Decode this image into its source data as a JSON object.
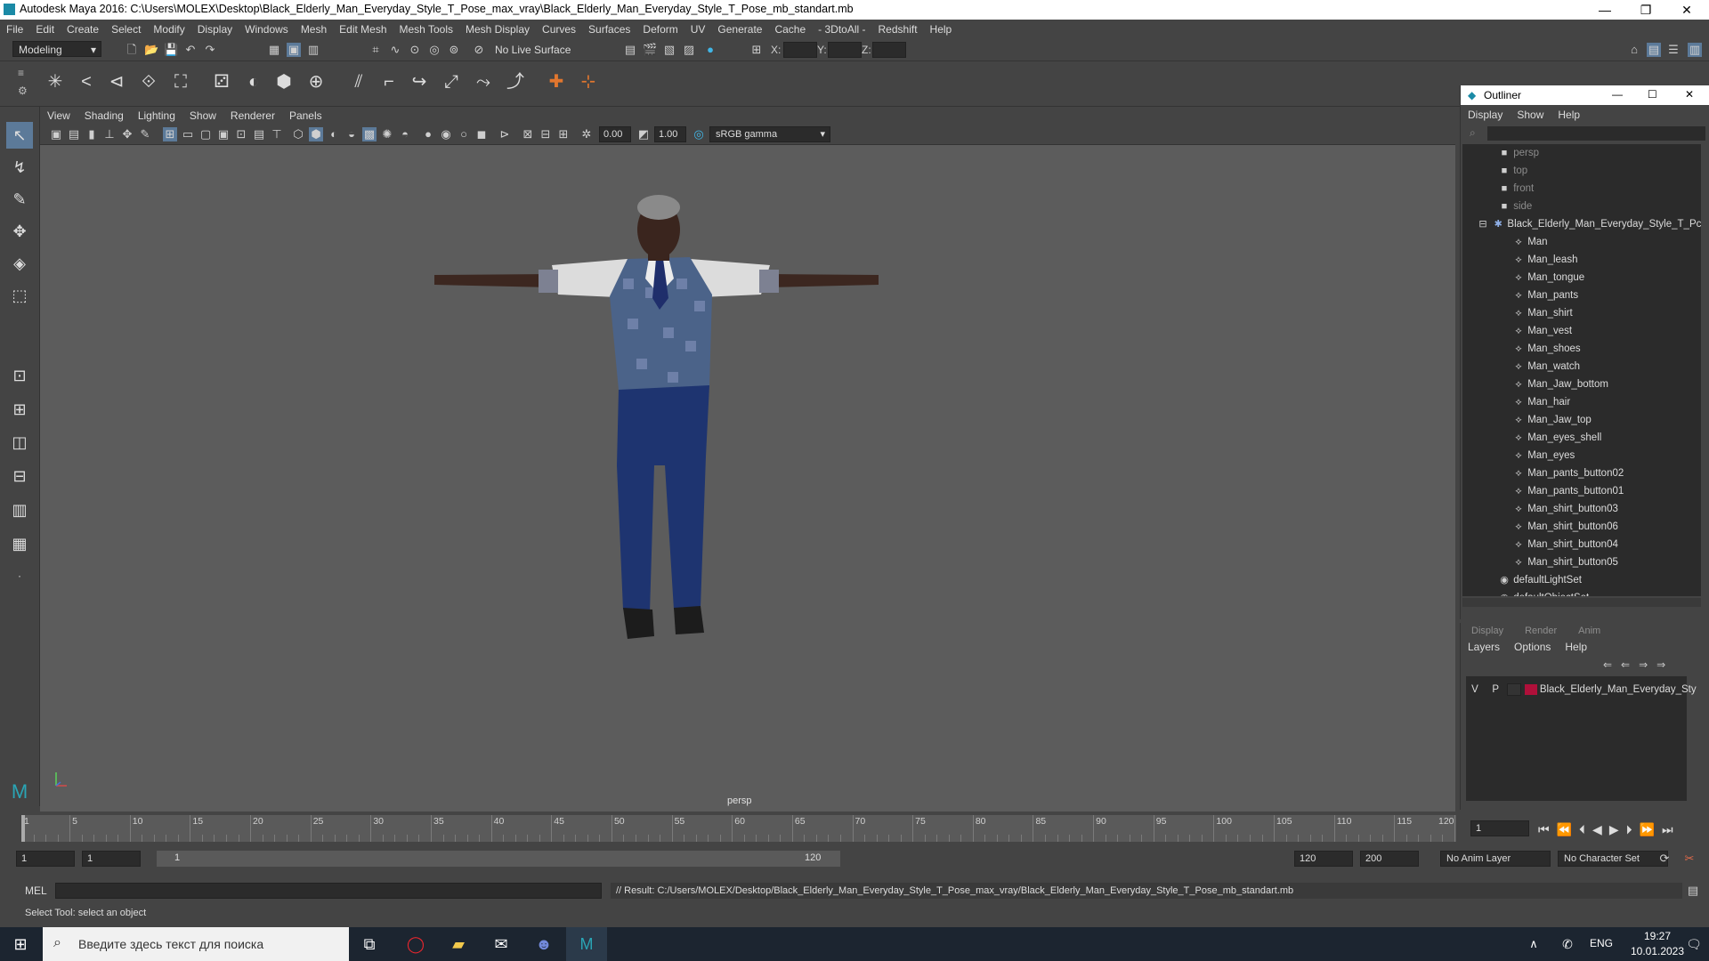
{
  "window": {
    "title": "Autodesk Maya 2016: C:\\Users\\MOLEX\\Desktop\\Black_Elderly_Man_Everyday_Style_T_Pose_max_vray\\Black_Elderly_Man_Everyday_Style_T_Pose_mb_standart.mb",
    "controls": [
      "—",
      "❐",
      "✕"
    ]
  },
  "menubar": [
    "File",
    "Edit",
    "Create",
    "Select",
    "Modify",
    "Display",
    "Windows",
    "Mesh",
    "Edit Mesh",
    "Mesh Tools",
    "Mesh Display",
    "Curves",
    "Surfaces",
    "Deform",
    "UV",
    "Generate",
    "Cache",
    "- 3DtoAll -",
    "Redshift",
    "Help"
  ],
  "statusline": {
    "workspace": "Modeling",
    "live_surface": "No Live Surface",
    "x_label": "X:",
    "y_label": "Y:",
    "z_label": "Z:"
  },
  "viewport": {
    "menu": [
      "View",
      "Shading",
      "Lighting",
      "Show",
      "Renderer",
      "Panels"
    ],
    "exposure": "0.00",
    "gamma": "1.00",
    "color_space": "sRGB gamma",
    "camera_label": "persp"
  },
  "outliner": {
    "title": "Outliner",
    "menu": [
      "Display",
      "Show",
      "Help"
    ],
    "cameras": [
      "persp",
      "top",
      "front",
      "side"
    ],
    "group": "Black_Elderly_Man_Everyday_Style_T_Pc",
    "children": [
      "Man",
      "Man_leash",
      "Man_tongue",
      "Man_pants",
      "Man_shirt",
      "Man_vest",
      "Man_shoes",
      "Man_watch",
      "Man_Jaw_bottom",
      "Man_hair",
      "Man_Jaw_top",
      "Man_eyes_shell",
      "Man_eyes",
      "Man_pants_button02",
      "Man_pants_button01",
      "Man_shirt_button03",
      "Man_shirt_button06",
      "Man_shirt_button04",
      "Man_shirt_button05"
    ],
    "sets": [
      "defaultLightSet",
      "defaultObjectSet"
    ]
  },
  "layer_editor": {
    "tabs": [
      "Display",
      "Render",
      "Anim"
    ],
    "menu": [
      "Layers",
      "Options",
      "Help"
    ],
    "layer": {
      "v": "V",
      "p": "P",
      "name": "Black_Elderly_Man_Everyday_Sty",
      "color": "#b0103a"
    }
  },
  "timeslider": {
    "ticks": [
      "1",
      "5",
      "10",
      "15",
      "20",
      "25",
      "30",
      "35",
      "40",
      "45",
      "50",
      "55",
      "60",
      "65",
      "70",
      "75",
      "80",
      "85",
      "90",
      "95",
      "100",
      "105",
      "110",
      "115",
      "120"
    ],
    "current_frame": "1"
  },
  "range": {
    "start": "1",
    "playback_start": "1",
    "slider_start": "1",
    "slider_end": "120",
    "playback_end": "120",
    "end": "200",
    "anim_layer": "No Anim Layer",
    "character_set": "No Character Set"
  },
  "cmdline": {
    "label": "MEL",
    "result": "// Result: C:/Users/MOLEX/Desktop/Black_Elderly_Man_Everyday_Style_T_Pose_max_vray/Black_Elderly_Man_Everyday_Style_T_Pose_mb_standart.mb"
  },
  "helpline": "Select Tool: select an object",
  "taskbar": {
    "search_placeholder": "Введите здесь текст для поиска",
    "lang": "ENG",
    "time": "19:27",
    "date": "10.01.2023"
  }
}
